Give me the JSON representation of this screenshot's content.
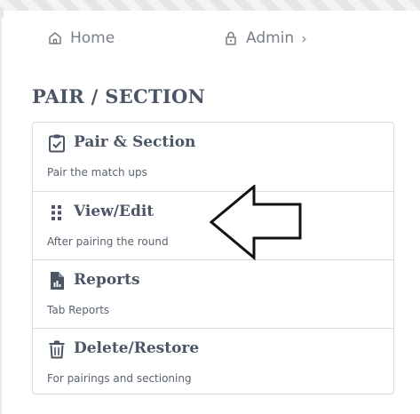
{
  "breadcrumb": {
    "home_label": "Home",
    "admin_label": "Admin",
    "separator": "›"
  },
  "page": {
    "title": "PAIR / SECTION"
  },
  "menu": {
    "items": [
      {
        "title": "Pair & Section",
        "description": "Pair the match ups",
        "icon": "clipboard-check-icon"
      },
      {
        "title": "View/Edit",
        "description": "After pairing the round",
        "icon": "grip-dots-icon"
      },
      {
        "title": "Reports",
        "description": "Tab Reports",
        "icon": "report-file-icon"
      },
      {
        "title": "Delete/Restore",
        "description": "For pairings and sectioning",
        "icon": "trash-icon"
      }
    ]
  },
  "colors": {
    "heading": "#4b5566",
    "muted": "#7a8089",
    "border": "#dcdcdc"
  }
}
